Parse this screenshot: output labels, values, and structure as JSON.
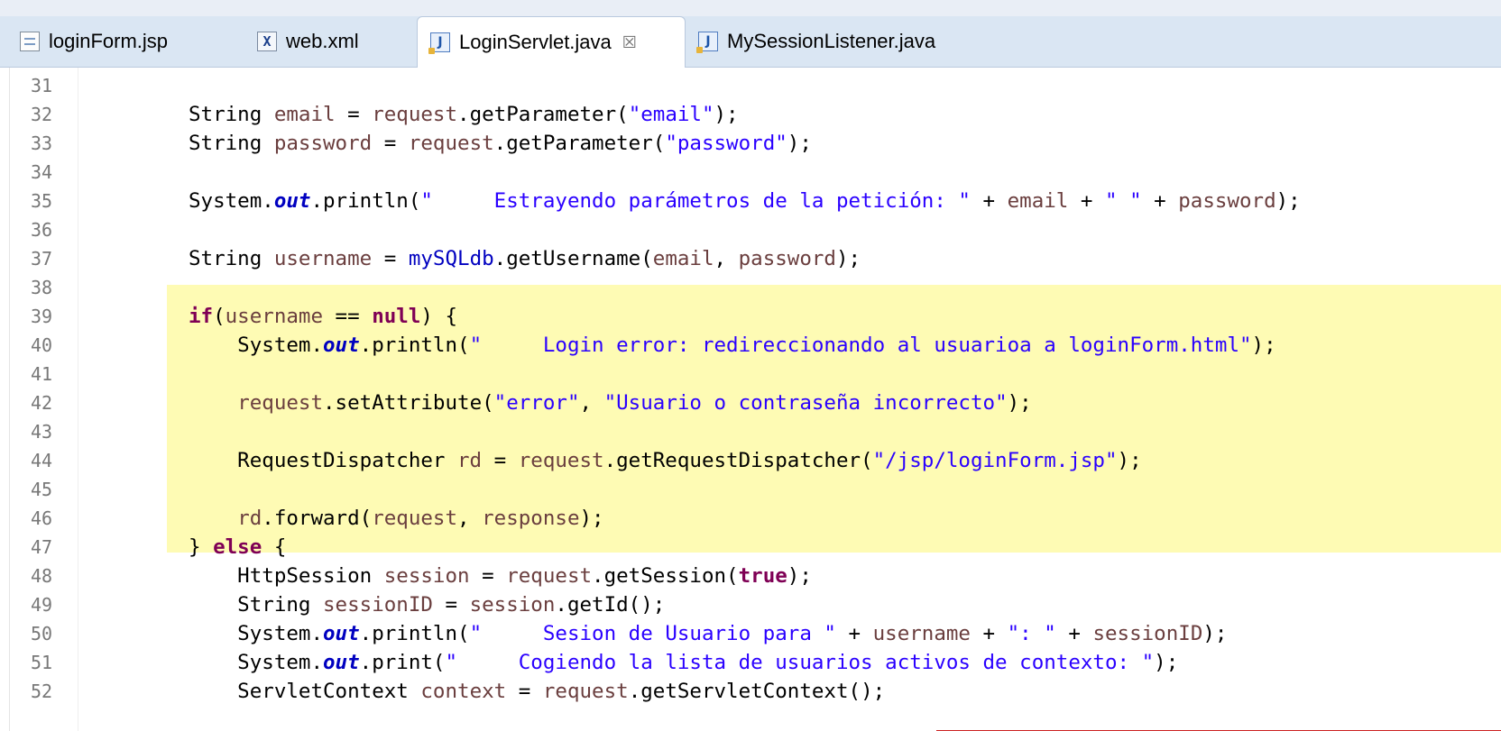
{
  "tabs": [
    {
      "label": "loginForm.jsp",
      "icon": "jsp-file-icon"
    },
    {
      "label": "web.xml",
      "icon": "xml-file-icon",
      "icon_glyph": "X"
    },
    {
      "label": "LoginServlet.java",
      "icon": "java-file-icon",
      "icon_glyph": "J",
      "active": true,
      "close_glyph": "☒"
    },
    {
      "label": "MySessionListener.java",
      "icon": "java-file-icon",
      "icon_glyph": "J"
    }
  ],
  "editor": {
    "highlight_color": "#fefbb4",
    "lines": [
      {
        "n": "31",
        "tokens": []
      },
      {
        "n": "32",
        "tokens": [
          {
            "t": "String ",
            "c": "pl"
          },
          {
            "t": "email",
            "c": "var"
          },
          {
            "t": " = ",
            "c": "pl"
          },
          {
            "t": "request",
            "c": "var"
          },
          {
            "t": ".getParameter(",
            "c": "pl"
          },
          {
            "t": "\"email\"",
            "c": "str"
          },
          {
            "t": ");",
            "c": "pl"
          }
        ]
      },
      {
        "n": "33",
        "tokens": [
          {
            "t": "String ",
            "c": "pl"
          },
          {
            "t": "password",
            "c": "var"
          },
          {
            "t": " = ",
            "c": "pl"
          },
          {
            "t": "request",
            "c": "var"
          },
          {
            "t": ".getParameter(",
            "c": "pl"
          },
          {
            "t": "\"password\"",
            "c": "str"
          },
          {
            "t": ");",
            "c": "pl"
          }
        ]
      },
      {
        "n": "34",
        "tokens": []
      },
      {
        "n": "35",
        "tokens": [
          {
            "t": "System.",
            "c": "pl"
          },
          {
            "t": "out",
            "c": "sfld"
          },
          {
            "t": ".println(",
            "c": "pl"
          },
          {
            "t": "\"     Estrayendo parámetros de la petición: \"",
            "c": "str"
          },
          {
            "t": " + ",
            "c": "pl"
          },
          {
            "t": "email",
            "c": "var"
          },
          {
            "t": " + ",
            "c": "pl"
          },
          {
            "t": "\" \"",
            "c": "str"
          },
          {
            "t": " + ",
            "c": "pl"
          },
          {
            "t": "password",
            "c": "var"
          },
          {
            "t": ");",
            "c": "pl"
          }
        ]
      },
      {
        "n": "36",
        "tokens": []
      },
      {
        "n": "37",
        "tokens": [
          {
            "t": "String ",
            "c": "pl"
          },
          {
            "t": "username",
            "c": "var"
          },
          {
            "t": " = ",
            "c": "pl"
          },
          {
            "t": "mySQLdb",
            "c": "fld"
          },
          {
            "t": ".getUsername(",
            "c": "pl"
          },
          {
            "t": "email",
            "c": "var"
          },
          {
            "t": ", ",
            "c": "pl"
          },
          {
            "t": "password",
            "c": "var"
          },
          {
            "t": ");",
            "c": "pl"
          }
        ]
      },
      {
        "n": "38",
        "tokens": []
      },
      {
        "n": "39",
        "tokens": [
          {
            "t": "if",
            "c": "kw"
          },
          {
            "t": "(",
            "c": "pl"
          },
          {
            "t": "username",
            "c": "var"
          },
          {
            "t": " == ",
            "c": "pl"
          },
          {
            "t": "null",
            "c": "kw"
          },
          {
            "t": ") {",
            "c": "pl"
          }
        ]
      },
      {
        "n": "40",
        "tokens": [
          {
            "t": "    System.",
            "c": "pl"
          },
          {
            "t": "out",
            "c": "sfld"
          },
          {
            "t": ".println(",
            "c": "pl"
          },
          {
            "t": "\"     Login error: redireccionando al usuarioa a loginForm.html\"",
            "c": "str"
          },
          {
            "t": ");",
            "c": "pl"
          }
        ]
      },
      {
        "n": "41",
        "tokens": []
      },
      {
        "n": "42",
        "tokens": [
          {
            "t": "    ",
            "c": "pl"
          },
          {
            "t": "request",
            "c": "var"
          },
          {
            "t": ".setAttribute(",
            "c": "pl"
          },
          {
            "t": "\"error\"",
            "c": "str"
          },
          {
            "t": ", ",
            "c": "pl"
          },
          {
            "t": "\"Usuario o contraseña incorrecto\"",
            "c": "str"
          },
          {
            "t": ");",
            "c": "pl"
          }
        ]
      },
      {
        "n": "43",
        "tokens": []
      },
      {
        "n": "44",
        "tokens": [
          {
            "t": "    RequestDispatcher ",
            "c": "pl"
          },
          {
            "t": "rd",
            "c": "var"
          },
          {
            "t": " = ",
            "c": "pl"
          },
          {
            "t": "request",
            "c": "var"
          },
          {
            "t": ".getRequestDispatcher(",
            "c": "pl"
          },
          {
            "t": "\"/jsp/loginForm.jsp\"",
            "c": "str"
          },
          {
            "t": ");",
            "c": "pl"
          }
        ]
      },
      {
        "n": "45",
        "tokens": []
      },
      {
        "n": "46",
        "tokens": [
          {
            "t": "    ",
            "c": "pl"
          },
          {
            "t": "rd",
            "c": "var"
          },
          {
            "t": ".forward(",
            "c": "pl"
          },
          {
            "t": "request",
            "c": "var"
          },
          {
            "t": ", ",
            "c": "pl"
          },
          {
            "t": "response",
            "c": "var"
          },
          {
            "t": ");",
            "c": "pl"
          }
        ]
      },
      {
        "n": "47",
        "tokens": [
          {
            "t": "} ",
            "c": "pl"
          },
          {
            "t": "else",
            "c": "kw"
          },
          {
            "t": " {",
            "c": "pl"
          }
        ]
      },
      {
        "n": "48",
        "tokens": [
          {
            "t": "    HttpSession ",
            "c": "pl"
          },
          {
            "t": "session",
            "c": "var"
          },
          {
            "t": " = ",
            "c": "pl"
          },
          {
            "t": "request",
            "c": "var"
          },
          {
            "t": ".getSession(",
            "c": "pl"
          },
          {
            "t": "true",
            "c": "kw"
          },
          {
            "t": ");",
            "c": "pl"
          }
        ]
      },
      {
        "n": "49",
        "tokens": [
          {
            "t": "    String ",
            "c": "pl"
          },
          {
            "t": "sessionID",
            "c": "var"
          },
          {
            "t": " = ",
            "c": "pl"
          },
          {
            "t": "session",
            "c": "var"
          },
          {
            "t": ".getId();",
            "c": "pl"
          }
        ]
      },
      {
        "n": "50",
        "tokens": [
          {
            "t": "    System.",
            "c": "pl"
          },
          {
            "t": "out",
            "c": "sfld"
          },
          {
            "t": ".println(",
            "c": "pl"
          },
          {
            "t": "\"     Sesion de Usuario para \"",
            "c": "str"
          },
          {
            "t": " + ",
            "c": "pl"
          },
          {
            "t": "username",
            "c": "var"
          },
          {
            "t": " + ",
            "c": "pl"
          },
          {
            "t": "\": \"",
            "c": "str"
          },
          {
            "t": " + ",
            "c": "pl"
          },
          {
            "t": "sessionID",
            "c": "var"
          },
          {
            "t": ");",
            "c": "pl"
          }
        ]
      },
      {
        "n": "51",
        "tokens": [
          {
            "t": "    System.",
            "c": "pl"
          },
          {
            "t": "out",
            "c": "sfld"
          },
          {
            "t": ".print(",
            "c": "pl"
          },
          {
            "t": "\"     Cogiendo la lista de usuarios activos de contexto: \"",
            "c": "str"
          },
          {
            "t": ");",
            "c": "pl"
          }
        ]
      },
      {
        "n": "52",
        "tokens": [
          {
            "t": "    ServletContext ",
            "c": "pl"
          },
          {
            "t": "context",
            "c": "var"
          },
          {
            "t": " = ",
            "c": "pl"
          },
          {
            "t": "request",
            "c": "var"
          },
          {
            "t": ".getServletContext();",
            "c": "pl"
          }
        ]
      }
    ]
  }
}
